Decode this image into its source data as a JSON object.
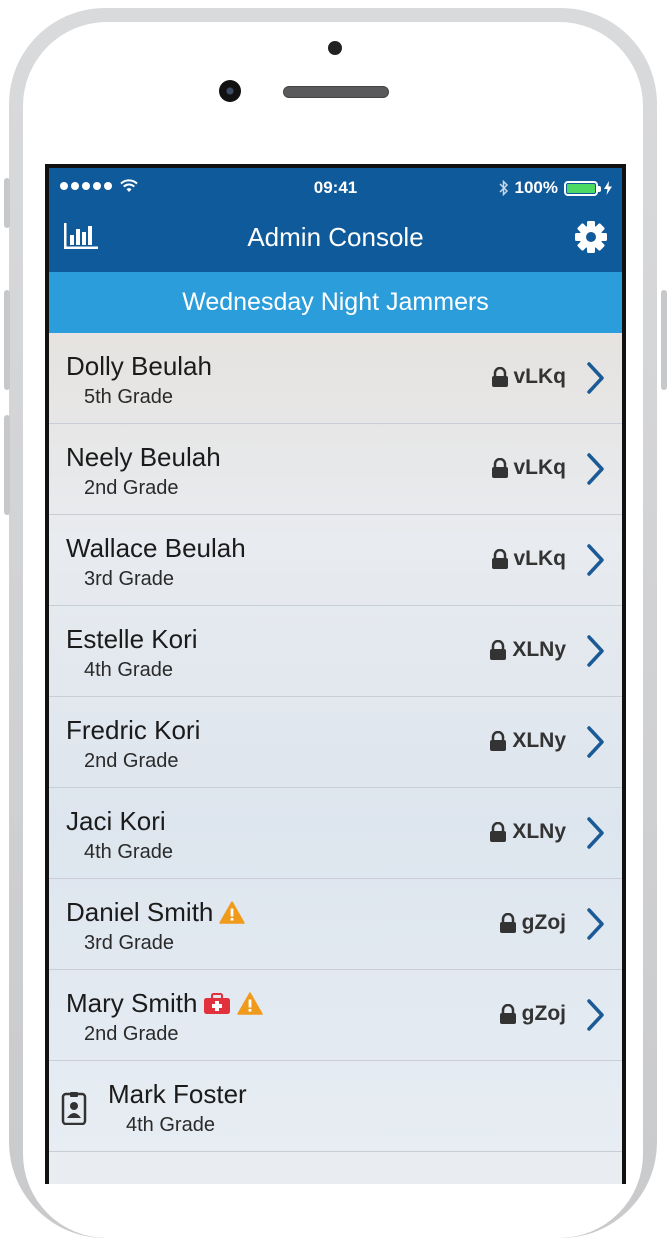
{
  "status_bar": {
    "time": "09:41",
    "battery": "100%",
    "signal_icon": "signal-dots-icon",
    "wifi_icon": "wifi-icon",
    "bluetooth_icon": "bluetooth-icon",
    "battery_icon": "battery-charging-icon"
  },
  "nav": {
    "title": "Admin Console",
    "left_icon": "stats-chart-icon",
    "right_icon": "gear-icon"
  },
  "group": {
    "title": "Wednesday Night Jammers"
  },
  "rows": [
    {
      "name": "Dolly Beulah",
      "grade": "5th Grade",
      "code": "vLKq"
    },
    {
      "name": "Neely Beulah",
      "grade": "2nd Grade",
      "code": "vLKq"
    },
    {
      "name": "Wallace Beulah",
      "grade": "3rd Grade",
      "code": "vLKq"
    },
    {
      "name": "Estelle Kori",
      "grade": "4th Grade",
      "code": "XLNy"
    },
    {
      "name": "Fredric Kori",
      "grade": "2nd Grade",
      "code": "XLNy"
    },
    {
      "name": "Jaci Kori",
      "grade": "4th Grade",
      "code": "XLNy"
    },
    {
      "name": "Daniel Smith",
      "grade": "3rd Grade",
      "code": "gZoj",
      "icons": [
        "warning-icon"
      ]
    },
    {
      "name": "Mary Smith",
      "grade": "2nd Grade",
      "code": "gZoj",
      "icons": [
        "medical-kit-icon",
        "warning-icon"
      ]
    },
    {
      "name": "Mark Foster",
      "grade": "4th Grade",
      "badge": "id-badge-icon"
    }
  ],
  "colors": {
    "nav_bg": "#0f5a9a",
    "header_bg": "#2c9ddb",
    "chevron": "#1a5a96",
    "warning": "#ef9a1a",
    "medical": "#e0313c"
  }
}
